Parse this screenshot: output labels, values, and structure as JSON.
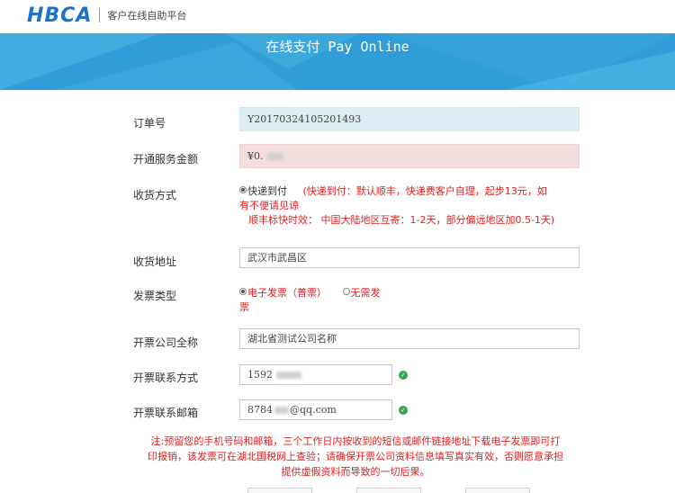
{
  "header": {
    "logo": "HBCA",
    "subtitle": "客户在线自助平台"
  },
  "banner": {
    "title": "在线支付 Pay Online"
  },
  "form": {
    "order_no": {
      "label": "订单号",
      "value": "Y20170324105201493"
    },
    "amount": {
      "label": "开通服务金额",
      "value": "¥0."
    },
    "shipping": {
      "label": "收货方式",
      "option": "快递到付",
      "hint1": "(快递到付：默认顺丰，快递费客户自理，起步13元，如",
      "hint2": "有不便请见谅",
      "hint3": "顺丰标快时效： 中国大陆地区互寄：1-2天，部分偏远地区加0.5-1天)"
    },
    "address": {
      "label": "收货地址",
      "value": "武汉市武昌区"
    },
    "invoice_type": {
      "label": "发票类型",
      "option1a": "电子发票（普票）",
      "option1b": "票",
      "option2": "无需发"
    },
    "company": {
      "label": "开票公司全称",
      "value": "湖北省测试公司名称"
    },
    "phone": {
      "label": "开票联系方式",
      "value": "1592"
    },
    "email": {
      "label": "开票联系邮箱",
      "value_a": "8784",
      "value_b": "@qq.com"
    }
  },
  "notice": {
    "line1": "注:预留您的手机号码和邮箱，三个工作日内按收到的短信或邮件链接地址下载电子发票即可打",
    "line2": "印报销，该发票可在湖北国税网上查验；请确保开票公司资料信息填写真实有效，否则愿意承担",
    "line3": "提供虚假资料而导致的一切后果。"
  },
  "colors": {
    "accent": "#2f9ed8",
    "brand": "#1e73c8",
    "warning": "#e02020",
    "ok": "#3aa553"
  }
}
